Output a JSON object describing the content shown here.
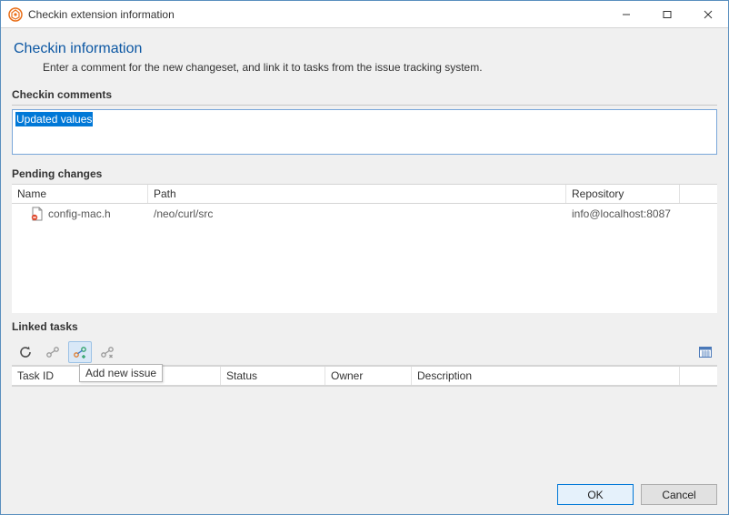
{
  "window": {
    "title": "Checkin extension information"
  },
  "page": {
    "title": "Checkin information",
    "subtitle": "Enter a comment for the new changeset, and link it to tasks from the issue tracking system."
  },
  "comments": {
    "section": "Checkin comments",
    "value": "Updated values"
  },
  "pending": {
    "section": "Pending changes",
    "columns": {
      "name": "Name",
      "path": "Path",
      "repo": "Repository"
    },
    "rows": [
      {
        "name": "config-mac.h",
        "path": "/neo/curl/src",
        "repo": "info@localhost:8087"
      }
    ]
  },
  "linked": {
    "section": "Linked tasks",
    "columns": {
      "id": "Task ID",
      "status": "Status",
      "owner": "Owner",
      "desc": "Description"
    },
    "tooltip": "Add new issue"
  },
  "buttons": {
    "ok": "OK",
    "cancel": "Cancel"
  }
}
